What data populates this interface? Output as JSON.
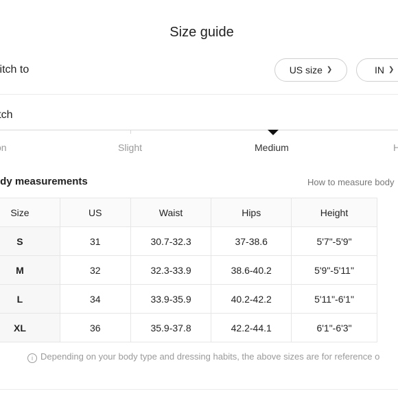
{
  "title": "Size guide",
  "switch": {
    "label": "witch to",
    "size_option": "US size",
    "unit_option": "IN"
  },
  "stretch": {
    "title": "retch",
    "levels": [
      "on",
      "Slight",
      "Medium",
      "H"
    ],
    "selected": "Medium"
  },
  "body_measurements": {
    "title": "ody measurements",
    "how_to_link": "How to measure body",
    "columns": [
      "Size",
      "US",
      "Waist",
      "Hips",
      "Height"
    ],
    "rows": [
      [
        "S",
        "31",
        "30.7-32.3",
        "37-38.6",
        "5'7\"-5'9\""
      ],
      [
        "M",
        "32",
        "32.3-33.9",
        "38.6-40.2",
        "5'9\"-5'11\""
      ],
      [
        "L",
        "34",
        "33.9-35.9",
        "40.2-42.2",
        "5'11\"-6'1\""
      ],
      [
        "XL",
        "36",
        "35.9-37.8",
        "42.2-44.1",
        "6'1\"-6'3\""
      ]
    ]
  },
  "note": "Depending on your body type and dressing habits, the above sizes are for reference o",
  "icons": {
    "dropdown": "chevron-down-icon",
    "info": "info-icon",
    "marker": "triangle-down-icon"
  }
}
